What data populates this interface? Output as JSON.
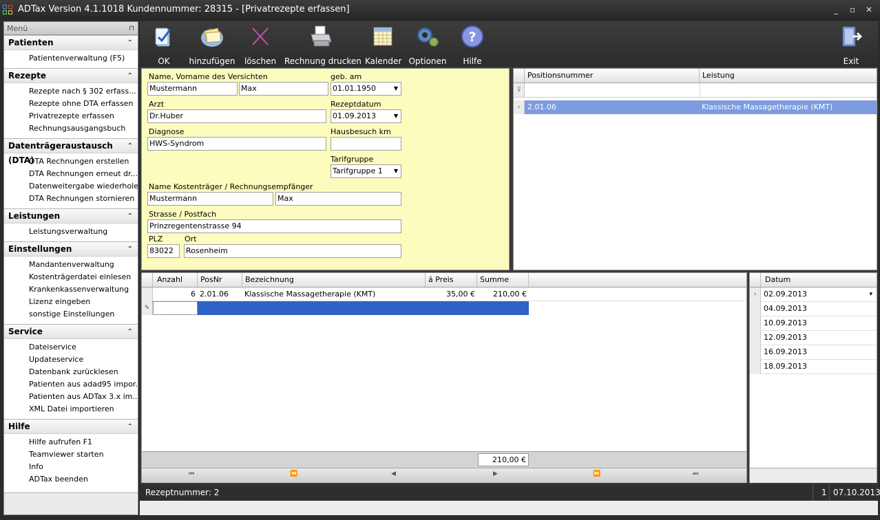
{
  "window": {
    "title": "ADTax  Version 4.1.1018  Kundennummer: 28315 - [Privatrezepte erfassen]",
    "controls": [
      "_",
      "▫",
      "✕"
    ]
  },
  "sidebar": {
    "header": "Menü",
    "groups": [
      {
        "title": "Patienten",
        "items": [
          "Patientenverwaltung (F5)"
        ]
      },
      {
        "title": "Rezepte",
        "items": [
          "Rezepte nach § 302 erfass...",
          "Rezepte ohne DTA erfassen",
          "Privatrezepte erfassen",
          "Rechnungsausgangsbuch"
        ]
      },
      {
        "title": "Datenträgeraustausch (DTA)",
        "items": [
          "DTA Rechnungen erstellen",
          "DTA Rechnungen erneut dr...",
          "Datenweitergabe wiederholen",
          "DTA Rechnungen stornieren"
        ]
      },
      {
        "title": "Leistungen",
        "items": [
          "Leistungsverwaltung"
        ]
      },
      {
        "title": "Einstellungen",
        "items": [
          "Mandantenverwaltung",
          "Kostenträgerdatei einlesen",
          "Krankenkassenverwaltung",
          "Lizenz eingeben",
          "sonstige Einstellungen"
        ]
      },
      {
        "title": "Service",
        "items": [
          "Dateiservice",
          "Updateservice",
          "Datenbank zurücklesen",
          "Patienten aus adad95 impor...",
          "Patienten aus ADTax 3.x im...",
          "XML Datei  importieren"
        ]
      },
      {
        "title": "Hilfe",
        "items": [
          "Hilfe aufrufen F1",
          "Teamviewer starten",
          "Info",
          "ADTax beenden"
        ]
      }
    ]
  },
  "toolbar": {
    "ok": "OK",
    "add": "hinzufügen",
    "delete": "löschen",
    "print": "Rechnung drucken",
    "calendar": "Kalender",
    "options": "Optionen",
    "help": "Hilfe",
    "exit": "Exit"
  },
  "form": {
    "name_label": "Name, Vorname des Versichten",
    "last_name": "Mustermann",
    "first_name": "Max",
    "dob_label": "geb. am",
    "dob": "01.01.1950",
    "doctor_label": "Arzt",
    "doctor": "Dr.Huber",
    "rx_date_label": "Rezeptdatum",
    "rx_date": "01.09.2013",
    "diagnosis_label": "Diagnose",
    "diagnosis": "HWS-Syndrom",
    "house_visit_label": "Hausbesuch km",
    "house_visit": "",
    "tariff_label": "Tarifgruppe",
    "tariff": "Tarifgruppe 1",
    "payer_label": "Name Kostenträger / Rechnungsempfänger",
    "payer_last": "Mustermann",
    "payer_first": "Max",
    "street_label": "Strasse / Postfach",
    "street": "Prinzregentenstrasse 94",
    "zip_label": "PLZ",
    "zip": "83022",
    "city_label": "Ort",
    "city": "Rosenheim"
  },
  "positions_grid": {
    "headers": [
      "Positionsnummer",
      "Leistung"
    ],
    "rows": [
      {
        "pos": "2.01.06",
        "service": "Klassische Massagetherapie (KMT)"
      }
    ]
  },
  "items_grid": {
    "headers": [
      "Anzahl",
      "PosNr",
      "Bezeichnung",
      "á Preis",
      "Summe"
    ],
    "rows": [
      {
        "qty": "6",
        "pos": "2.01.06",
        "desc": "Klassische Massagetherapie (KMT)",
        "price": "35,00 €",
        "sum": "210,00 €"
      }
    ],
    "total": "210,00 €"
  },
  "dates_grid": {
    "header": "Datum",
    "dates": [
      "02.09.2013",
      "04.09.2013",
      "10.09.2013",
      "12.09.2013",
      "16.09.2013",
      "18.09.2013"
    ]
  },
  "status": {
    "recipe": "Rezeptnummer: 2",
    "page": "1",
    "date": "07.10.2013"
  },
  "colors": {
    "form_bg": "#fcfcbe",
    "selection": "#2f62c8",
    "chrome_dark": "#2b2b2b"
  }
}
